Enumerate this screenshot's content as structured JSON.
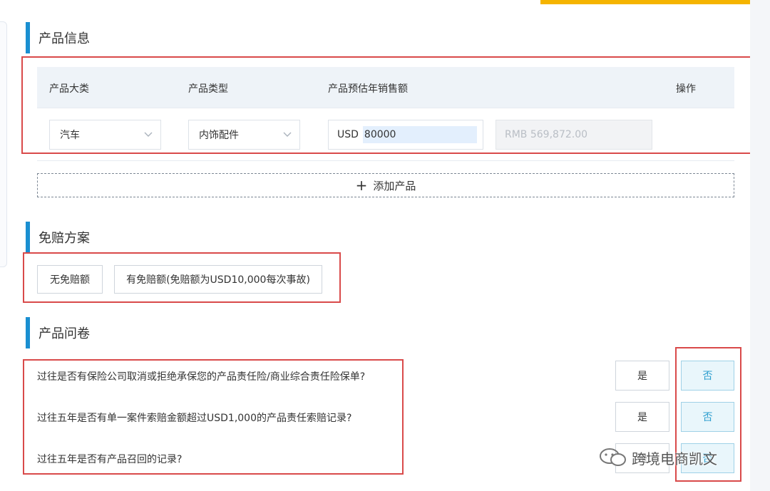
{
  "product_info": {
    "title": "产品信息",
    "headers": {
      "category": "产品大类",
      "type": "产品类型",
      "sales": "产品预估年销售额",
      "action": "操作"
    },
    "row": {
      "category": "汽车",
      "type": "内饰配件",
      "currency": "USD",
      "amount": "80000",
      "rmb": "RMB 569,872.00"
    },
    "add_label": "添加产品"
  },
  "deductible": {
    "title": "免赔方案",
    "options": [
      "无免赔额",
      "有免赔额(免赔额为USD10,000每次事故)"
    ]
  },
  "questionnaire": {
    "title": "产品问卷",
    "questions": [
      "过往是否有保险公司取消或拒绝承保您的产品责任险/商业综合责任险保单?",
      "过往五年是否有单一案件索赔金额超过USD1,000的产品责任索赔记录?",
      "过往五年是否有产品召回的记录?"
    ],
    "yes_label": "是",
    "no_label": "否"
  },
  "watermark": "跨境电商凯文",
  "colors": {
    "accent_blue": "#1a8fd1",
    "highlight_red": "#d94a4a",
    "top_bar": "#f5b400",
    "no_button_text": "#2e9fcf"
  }
}
